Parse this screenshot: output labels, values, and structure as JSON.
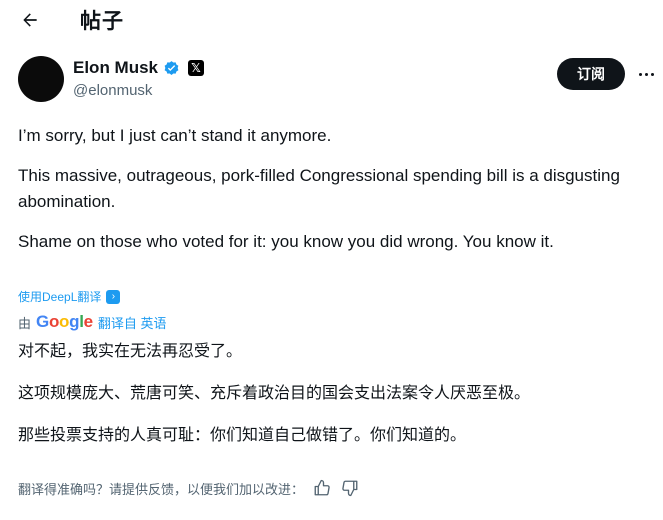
{
  "header": {
    "back_icon": "arrow-left-icon",
    "title": "帖子"
  },
  "author": {
    "display_name": "Elon Musk",
    "handle": "@elonmusk",
    "verified_icon": "verified-badge-icon",
    "affiliation_icon": "x-logo-icon",
    "affiliation_label": "𝕏"
  },
  "actions": {
    "subscribe_label": "订阅",
    "more_icon": "more-horizontal-icon"
  },
  "post": {
    "line1": "I’m sorry, but I just can’t stand it anymore.",
    "line2": "This massive, outrageous, pork-filled Congressional spending bill is a disgusting abomination.",
    "line3": "Shame on those who voted for it: you know you did wrong. You know it."
  },
  "deepl": {
    "label": "使用DeepL翻译",
    "icon": "deepl-icon",
    "icon_glyph": "›"
  },
  "google_translate": {
    "prefix": "由",
    "logo": {
      "G": "G",
      "o1": "o",
      "o2": "o",
      "g": "g",
      "l": "l",
      "e": "e"
    },
    "label": "翻译自 英语"
  },
  "translation": {
    "line1": "对不起，我实在无法再忍受了。",
    "line2": "这项规模庞大、荒唐可笑、充斥着政治目的国会支出法案令人厌恶至极。",
    "line3": "那些投票支持的人真可耻：你们知道自己做错了。你们知道的。"
  },
  "feedback": {
    "prompt": "翻译得准确吗？请提供反馈，以便我们加以改进：",
    "thumbs_up_icon": "thumbs-up-icon",
    "thumbs_down_icon": "thumbs-down-icon"
  },
  "colors": {
    "accent": "#1d9bf0",
    "text": "#0f1419",
    "muted": "#536471",
    "button": "#0f1419"
  }
}
